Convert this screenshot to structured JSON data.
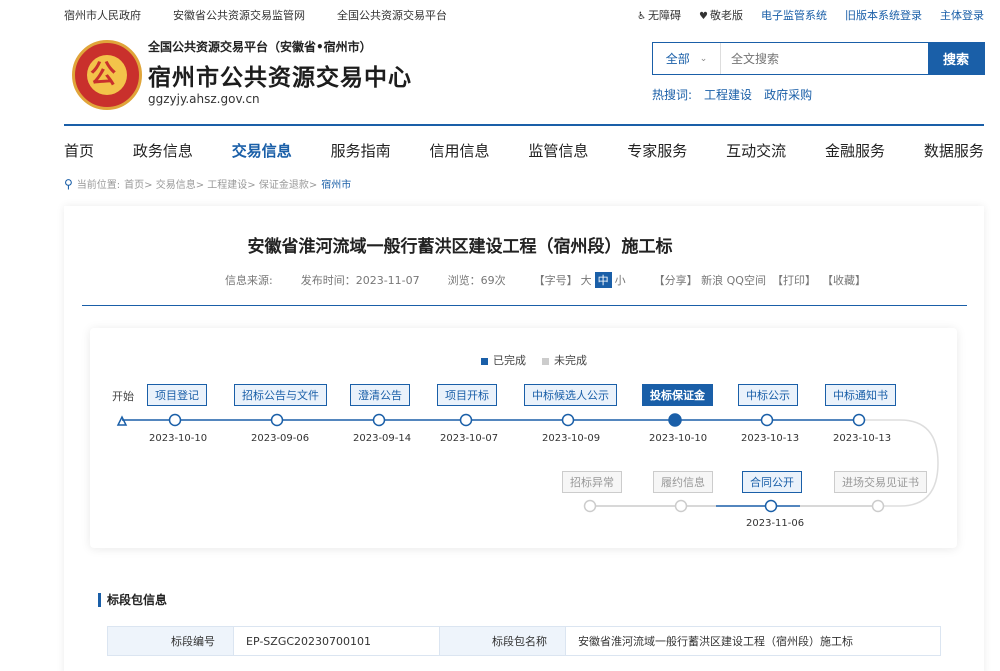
{
  "topbar": {
    "left_links": [
      "宿州市人民政府",
      "安徽省公共资源交易监管网",
      "全国公共资源交易平台"
    ],
    "accessibility": "无障碍",
    "elder": "敬老版",
    "right_links": [
      "电子监管系统",
      "旧版本系统登录",
      "主体登录"
    ]
  },
  "header": {
    "subtitle": "全国公共资源交易平台（安徽省•宿州市）",
    "title": "宿州市公共资源交易中心",
    "url": "ggzyjy.ahsz.gov.cn"
  },
  "search": {
    "scope": "全部",
    "placeholder": "全文搜索",
    "button": "搜索",
    "hot_label": "热搜词:",
    "hot_words": [
      "工程建设",
      "政府采购"
    ]
  },
  "nav": {
    "items": [
      "首页",
      "政务信息",
      "交易信息",
      "服务指南",
      "信用信息",
      "监管信息",
      "专家服务",
      "互动交流",
      "金融服务",
      "数据服务"
    ],
    "active": "交易信息"
  },
  "breadcrumb": {
    "label": "当前位置:",
    "path": "首页> 交易信息> 工程建设> 保证金退款>",
    "current": "宿州市"
  },
  "article": {
    "title": "安徽省淮河流域一般行蓄洪区建设工程（宿州段）施工标",
    "source": "信息来源:",
    "publish": "发布时间：2023-11-07",
    "views": "浏览：69次",
    "font_label": "【字号】",
    "font_big": "大",
    "font_mid": "中",
    "font_small": "小",
    "share": "【分享】 新浪 QQ空间",
    "print": "【打印】",
    "collect": "【收藏】"
  },
  "timeline": {
    "legend_done": "已完成",
    "legend_todo": "未完成",
    "start": "开始",
    "row1": [
      {
        "label": "项目登记",
        "date": "2023-10-10"
      },
      {
        "label": "招标公告与文件",
        "date": "2023-09-06"
      },
      {
        "label": "澄清公告",
        "date": "2023-09-14"
      },
      {
        "label": "项目开标",
        "date": "2023-10-07"
      },
      {
        "label": "中标候选人公示",
        "date": "2023-10-09"
      },
      {
        "label": "投标保证金",
        "date": "2023-10-10"
      },
      {
        "label": "中标公示",
        "date": "2023-10-13"
      },
      {
        "label": "中标通知书",
        "date": "2023-10-13"
      }
    ],
    "row2": [
      {
        "label": "招标异常",
        "date": ""
      },
      {
        "label": "履约信息",
        "date": ""
      },
      {
        "label": "合同公开",
        "date": "2023-11-06"
      },
      {
        "label": "进场交易见证书",
        "date": ""
      }
    ],
    "colors": {
      "done": "#1a5fa8",
      "todo": "#cccccc"
    }
  },
  "section": {
    "title": "标段包信息",
    "rows": [
      {
        "label1": "标段编号",
        "value1": "EP-SZGC20230700101",
        "label2": "标段包名称",
        "value2": "安徽省淮河流域一般行蓄洪区建设工程（宿州段）施工标"
      }
    ]
  }
}
